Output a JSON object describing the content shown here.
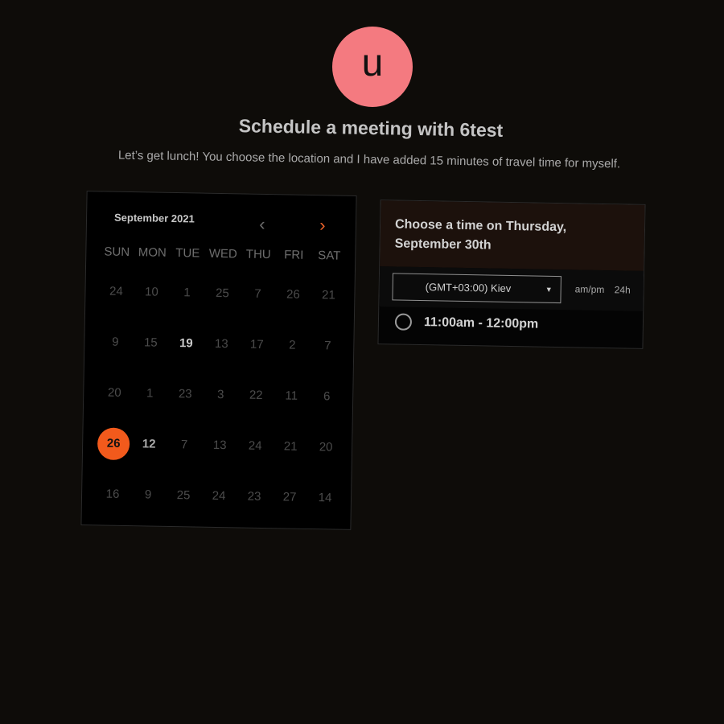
{
  "profile": {
    "avatar_letter": "u",
    "avatar_color": "#f47a80"
  },
  "page": {
    "title": "Schedule a meeting with 6test",
    "description": "Let’s get lunch! You choose the location and I have added 15 minutes of travel time for myself."
  },
  "calendar": {
    "month_label": "September 2021",
    "prev_icon": "chevron-left-icon",
    "next_icon": "chevron-right-icon",
    "weekdays": [
      "SUN",
      "MON",
      "TUE",
      "WED",
      "THU",
      "FRI",
      "SAT"
    ],
    "weeks": [
      [
        "24",
        "10",
        "1",
        "25",
        "7",
        "26",
        "21"
      ],
      [
        "9",
        "15",
        "19",
        "13",
        "17",
        "2",
        "7"
      ],
      [
        "20",
        "1",
        "23",
        "3",
        "22",
        "11",
        "6"
      ],
      [
        "26",
        "12",
        "7",
        "13",
        "24",
        "21",
        "20"
      ],
      [
        "16",
        "9",
        "25",
        "24",
        "23",
        "27",
        "14"
      ]
    ],
    "selected_day": "26",
    "accent_color": "#f25a1c"
  },
  "time_panel": {
    "heading_line1": "Choose a time on Thursday,",
    "heading_line2": "September 30th",
    "timezone": "(GMT+03:00) Kiev",
    "format_ampm": "am/pm",
    "format_24h": "24h",
    "slots": [
      "11:00am - 12:00pm"
    ]
  }
}
